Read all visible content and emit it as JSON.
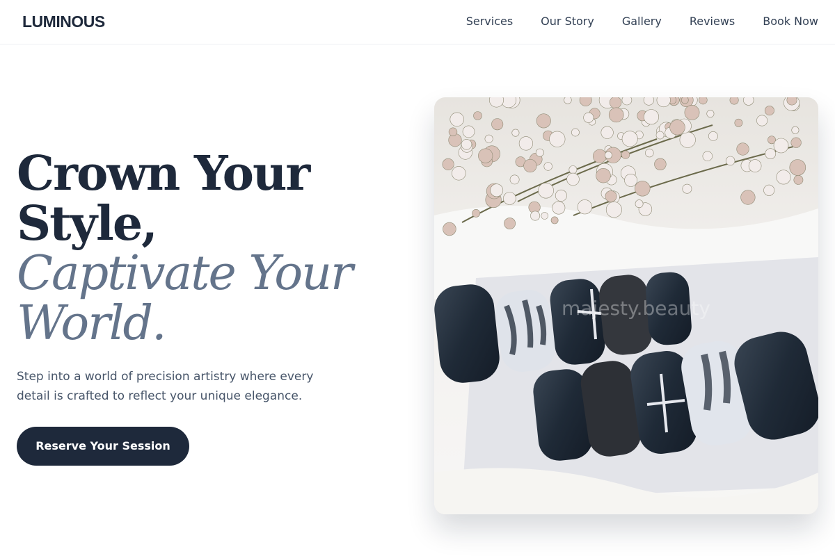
{
  "brand": {
    "name": "LUMINOUS"
  },
  "nav": {
    "items": [
      {
        "label": "Services"
      },
      {
        "label": "Our Story"
      },
      {
        "label": "Gallery"
      },
      {
        "label": "Reviews"
      },
      {
        "label": "Book Now"
      }
    ]
  },
  "hero": {
    "headline": {
      "line1": "Crown Your",
      "line2": "Style,",
      "line3": "Captivate Your",
      "line4": "World."
    },
    "subtitle": "Step into a world of precision artistry where every detail is crafted to reflect your unique elegance.",
    "cta_label": "Reserve Your Session",
    "image": {
      "subject": "dark navy press-on nails with white marble, glitter and star designs beside dried flowers",
      "watermark": "majesty.beauty"
    }
  },
  "colors": {
    "primary": "#1e293b",
    "muted": "#64748b",
    "text": "#475569"
  }
}
